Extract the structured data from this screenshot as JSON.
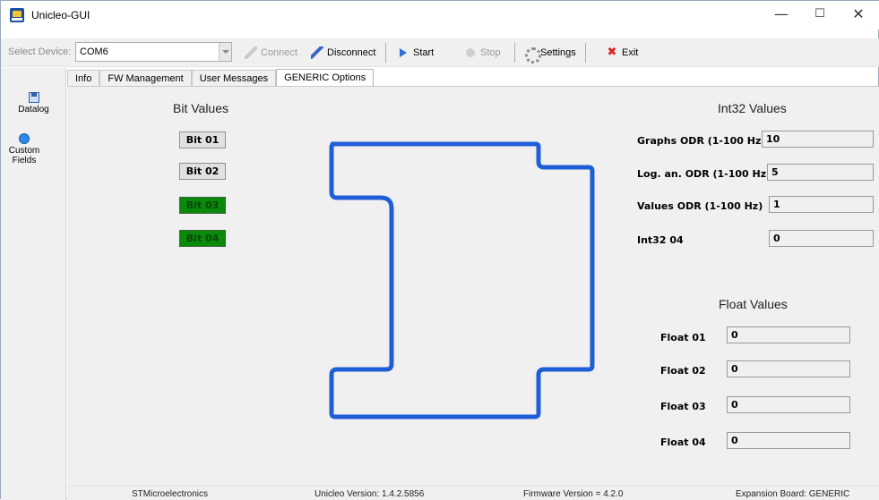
{
  "window": {
    "title": "Unicleo-GUI",
    "minimize_glyph": "—",
    "maximize_glyph": "☐",
    "close_glyph": "✕"
  },
  "toolbar": {
    "device_label": "Select Device:",
    "device_value": "COM6",
    "connect_label": "Connect",
    "disconnect_label": "Disconnect",
    "start_label": "Start",
    "stop_label": "Stop",
    "settings_label": "Settings",
    "exit_label": "Exit"
  },
  "sidebar": {
    "items": [
      {
        "label": "Datalog",
        "icon": "floppy-icon"
      },
      {
        "label": "Custom Fields",
        "icon": "globe-icon"
      }
    ]
  },
  "tabs": [
    {
      "label": "Info",
      "active": false
    },
    {
      "label": "FW Management",
      "active": false
    },
    {
      "label": "User Messages",
      "active": false
    },
    {
      "label": "GENERIC Options",
      "active": true
    }
  ],
  "bit_values": {
    "heading": "Bit Values",
    "items": [
      {
        "label": "Bit 01",
        "on": false
      },
      {
        "label": "Bit 02",
        "on": false
      },
      {
        "label": "Bit 03",
        "on": true
      },
      {
        "label": "Bit 04",
        "on": true
      }
    ]
  },
  "int32_values": {
    "heading": "Int32 Values",
    "items": [
      {
        "label": "Graphs ODR (1-100 Hz)",
        "value": "10"
      },
      {
        "label": "Log. an. ODR (1-100 Hz)",
        "value": "5"
      },
      {
        "label": "Values ODR (1-100 Hz)",
        "value": "1"
      },
      {
        "label": "Int32 04",
        "value": "0"
      }
    ]
  },
  "float_values": {
    "heading": "Float Values",
    "items": [
      {
        "label": "Float 01",
        "value": "0"
      },
      {
        "label": "Float 02",
        "value": "0"
      },
      {
        "label": "Float 03",
        "value": "0"
      },
      {
        "label": "Float 04",
        "value": "0"
      }
    ]
  },
  "footer": {
    "company": "STMicroelectronics",
    "unicleo_version": "Unicleo Version:  1.4.2.5856",
    "firmware_version": "Firmware Version = 4.2.0",
    "expansion_board": "Expansion Board: GENERIC"
  },
  "colors": {
    "bit_on": "#0a8a0a",
    "outline": "#1f5ed6",
    "exit_icon": "#e02020"
  }
}
